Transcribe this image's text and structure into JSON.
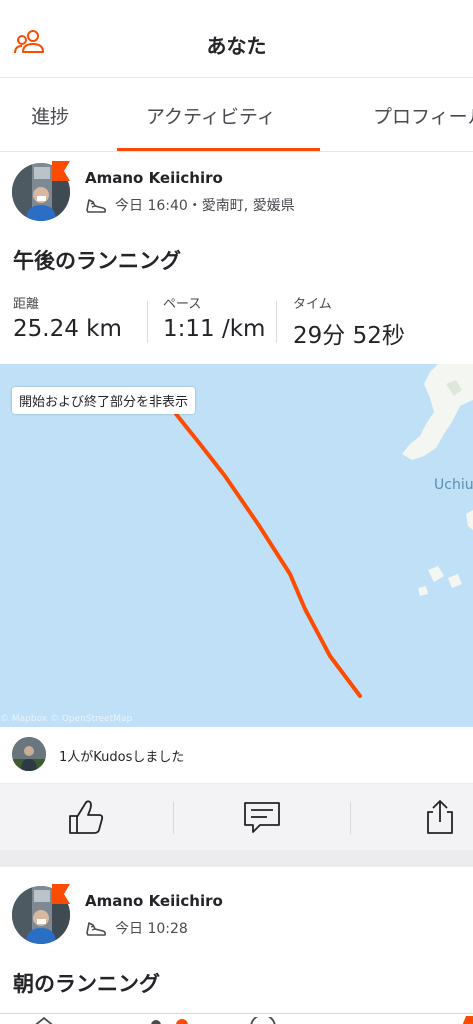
{
  "header": {
    "title": "あなた",
    "friends_icon": "friends-icon"
  },
  "tabs": [
    {
      "label": "進捗"
    },
    {
      "label": "アクティビティ",
      "active": true
    },
    {
      "label": "プロフィール"
    }
  ],
  "activities": [
    {
      "athlete": "Amano Keiichiro",
      "meta": "今日 16:40・愛南町, 愛媛県",
      "sport_icon": "running-shoe-icon",
      "title": "午後のランニング",
      "stats": [
        {
          "label": "距離",
          "value": "25.24 km"
        },
        {
          "label": "ペース",
          "value": "1:11 /km"
        },
        {
          "label": "タイム",
          "value": "29分 52秒"
        }
      ],
      "map": {
        "hide_button": "開始および終了部分を非表示",
        "place_label": "Uchiu",
        "attribution": "© Mapbox © OpenStreetMap"
      },
      "kudos_text": "1人がKudosしました",
      "actions": [
        "kudos-thumb-icon",
        "comment-icon",
        "share-icon"
      ]
    },
    {
      "athlete": "Amano Keiichiro",
      "meta": "今日 10:28",
      "sport_icon": "running-shoe-icon",
      "title": "朝のランニング"
    }
  ],
  "colors": {
    "accent": "#fc4c02",
    "map_water": "#bfe0f7",
    "text": "#242428"
  }
}
